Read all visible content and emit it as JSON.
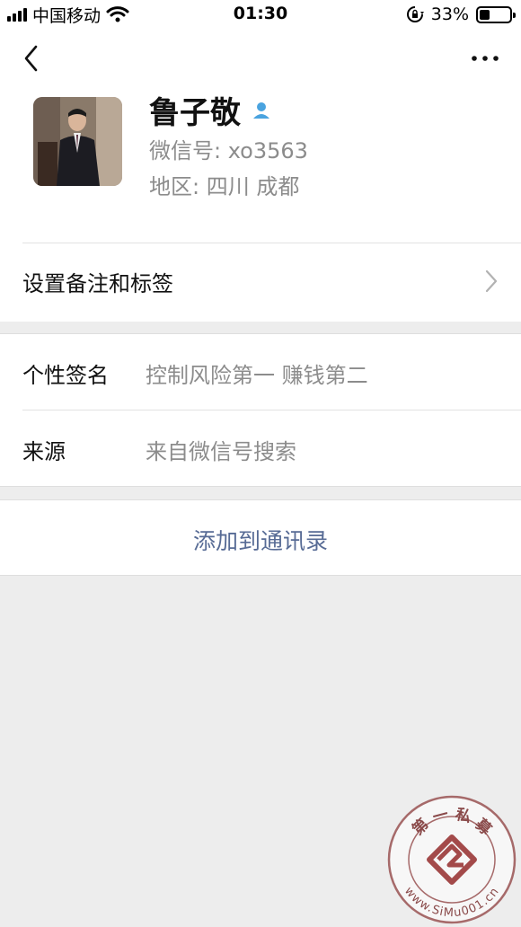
{
  "status_bar": {
    "carrier": "中国移动",
    "time": "01:30",
    "battery_percent": "33%",
    "battery_level": 0.33
  },
  "nav": {
    "back_icon": "chevron-left-icon",
    "more_icon": "more-dots-icon"
  },
  "profile": {
    "name": "鲁子敬",
    "wechat_id": "微信号:  xo3563",
    "region": "地区:  四川 成都",
    "contact_icon": "person-icon"
  },
  "remark": {
    "label": "设置备注和标签"
  },
  "details": [
    {
      "key": "个性签名",
      "value": "控制风险第一 赚钱第二"
    },
    {
      "key": "来源",
      "value": "来自微信号搜索"
    }
  ],
  "add_button": {
    "label": "添加到通讯录"
  },
  "watermark": {
    "top_text": "第 一 私 募",
    "bottom_text": "www.SiMu001.cn"
  },
  "colors": {
    "link_blue": "#576b95",
    "secondary_gray": "#8c8c8c",
    "background": "#ededed",
    "watermark_red": "#a66a6a"
  }
}
